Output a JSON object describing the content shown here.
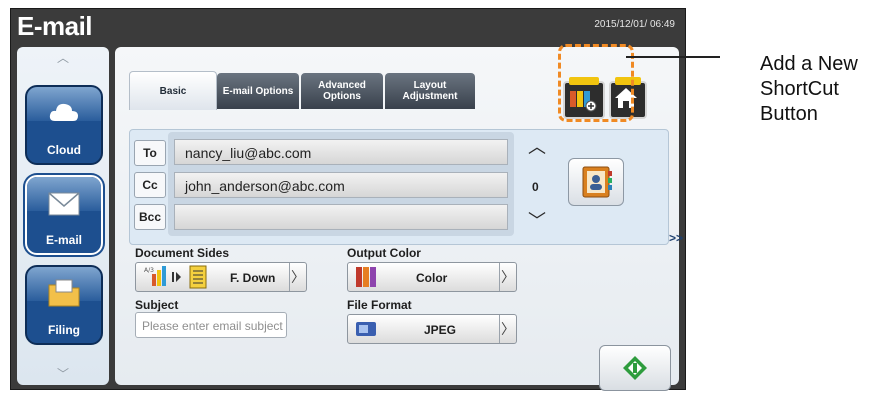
{
  "header": {
    "title": "E-mail",
    "datetime": "2015/12/01/ 06:49"
  },
  "sidebar": {
    "items": [
      {
        "label": "Cloud",
        "icon": "cloud-icon"
      },
      {
        "label": "E-mail",
        "icon": "envelope-icon"
      },
      {
        "label": "Filing",
        "icon": "folder-icon"
      }
    ]
  },
  "tabs": [
    {
      "label": "Basic",
      "active": true
    },
    {
      "label": "E-mail Options",
      "active": false
    },
    {
      "label": "Advanced Options",
      "active": false
    },
    {
      "label": "Layout Adjustment",
      "active": false
    }
  ],
  "toolbar": {
    "add_shortcut_icon": "add-shortcut-icon",
    "home_icon": "home-icon"
  },
  "addresses": {
    "to_label": "To",
    "cc_label": "Cc",
    "bcc_label": "Bcc",
    "to_value": "nancy_liu@abc.com",
    "cc_value": "john_anderson@abc.com",
    "bcc_value": "",
    "count": "0",
    "address_book_icon": "address-book-icon"
  },
  "document_sides": {
    "label": "Document Sides",
    "value": "F. Down"
  },
  "output_color": {
    "label": "Output Color",
    "value": "Color"
  },
  "subject": {
    "label": "Subject",
    "placeholder": "Please enter email subject"
  },
  "file_format": {
    "label": "File Format",
    "value": "JPEG"
  },
  "more": {
    "label": ">>"
  },
  "callout": {
    "text": "Add a New ShortCut Button"
  },
  "colors": {
    "frame": "#3b3b3b",
    "accent": "#1d4f8f",
    "highlight": "#f08a24",
    "start_green": "#2e9c3e"
  }
}
